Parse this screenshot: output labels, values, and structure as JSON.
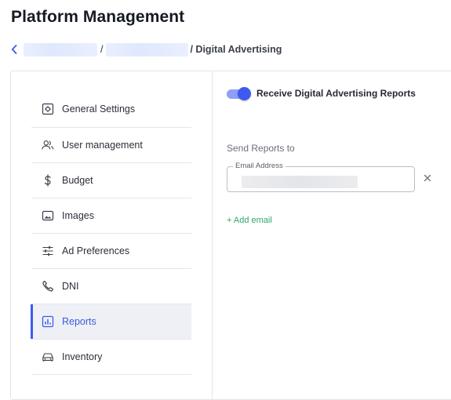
{
  "header": {
    "title": "Platform Management"
  },
  "breadcrumb": {
    "separator": "/",
    "current": "/ Digital Advertising"
  },
  "sidebar": {
    "items": [
      {
        "label": "General Settings",
        "icon": "gear-icon"
      },
      {
        "label": "User management",
        "icon": "users-icon"
      },
      {
        "label": "Budget",
        "icon": "dollar-icon"
      },
      {
        "label": "Images",
        "icon": "image-icon"
      },
      {
        "label": "Ad Preferences",
        "icon": "sliders-icon"
      },
      {
        "label": "DNI",
        "icon": "phone-icon"
      },
      {
        "label": "Reports",
        "icon": "chart-icon",
        "active": true
      },
      {
        "label": "Inventory",
        "icon": "car-icon"
      }
    ]
  },
  "reports": {
    "toggle_label": "Receive Digital Advertising Reports",
    "toggle_on": true,
    "send_label": "Send Reports to",
    "email_legend": "Email Address",
    "add_email": "+ Add email"
  },
  "colors": {
    "accent": "#3d5af1",
    "link_green": "#2fa56b"
  }
}
